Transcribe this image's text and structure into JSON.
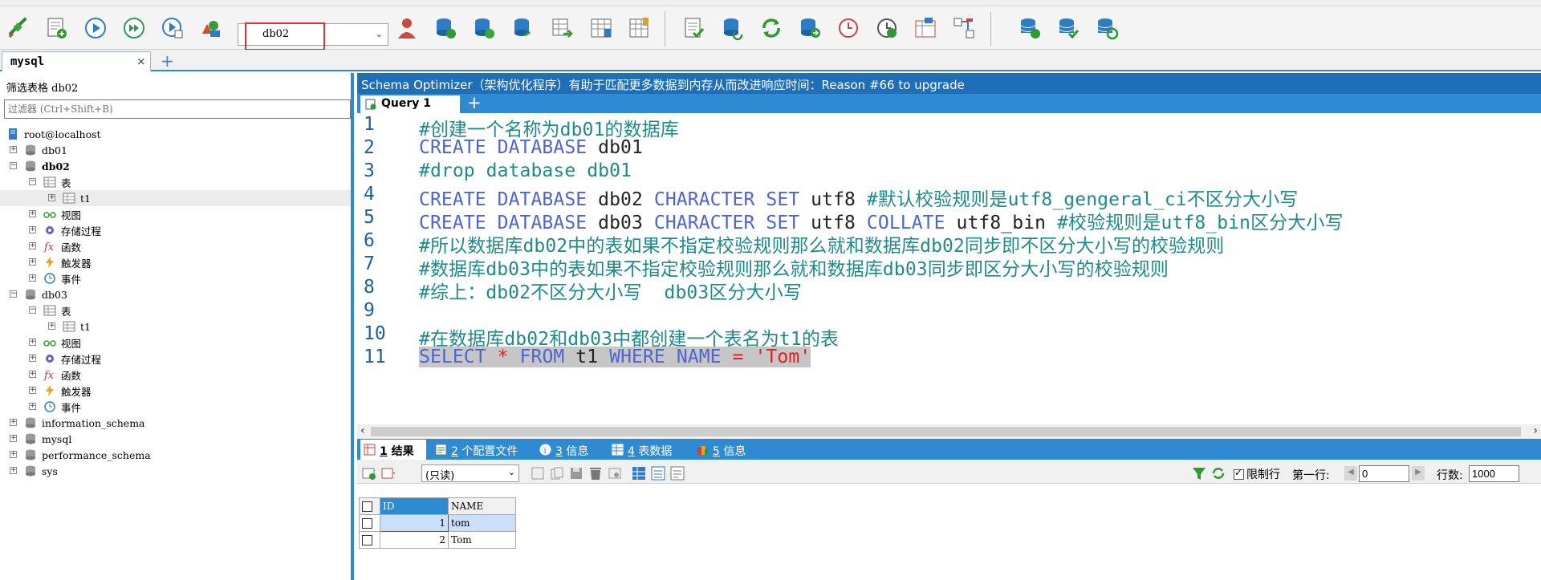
{
  "toolbar": {
    "db_selected": "db02",
    "icons": [
      "connect-icon",
      "new-query-icon",
      "execute-icon",
      "execute-all-icon",
      "execute-explain-icon",
      "new-database-icon",
      "db-select",
      "user-manager-icon",
      "create-table-icon",
      "alter-table-icon",
      "copy-table-icon",
      "import-icon",
      "schema-designer-icon",
      "table-diagnostics-icon",
      "query-builder-icon",
      "backup-icon",
      "restore-icon",
      "sync-icon",
      "database-export-icon",
      "schedule-icon",
      "job-icon",
      "schema-sync-icon",
      "data-sync-icon",
      "stack-add-icon",
      "stack-check-icon",
      "stack-refresh-icon"
    ]
  },
  "connection_tab": {
    "label": "mysql",
    "close": "×",
    "add": "+"
  },
  "object_browser": {
    "filter_label": "筛选表格 db02",
    "filter_placeholder": "过滤器 (Ctrl+Shift+B)",
    "tree": [
      {
        "label": "root@localhost",
        "icon": "server"
      },
      {
        "label": "db01",
        "icon": "database",
        "exp": "+"
      },
      {
        "label": "db02",
        "icon": "database",
        "exp": "-",
        "bold": true
      },
      {
        "label": "表",
        "icon": "table-folder",
        "exp": "-"
      },
      {
        "label": "t1",
        "icon": "table",
        "exp": "+",
        "selected": true
      },
      {
        "label": "视图",
        "icon": "views",
        "exp": "+"
      },
      {
        "label": "存储过程",
        "icon": "gear",
        "exp": "+"
      },
      {
        "label": "函数",
        "icon": "function",
        "exp": "+"
      },
      {
        "label": "触发器",
        "icon": "trigger",
        "exp": "+"
      },
      {
        "label": "事件",
        "icon": "clock",
        "exp": "+"
      },
      {
        "label": "db03",
        "icon": "database",
        "exp": "-"
      },
      {
        "label": "表",
        "icon": "table-folder",
        "exp": "-"
      },
      {
        "label": "t1",
        "icon": "table",
        "exp": "+"
      },
      {
        "label": "视图",
        "icon": "views",
        "exp": "+"
      },
      {
        "label": "存储过程",
        "icon": "gear",
        "exp": "+"
      },
      {
        "label": "函数",
        "icon": "function",
        "exp": "+"
      },
      {
        "label": "触发器",
        "icon": "trigger",
        "exp": "+"
      },
      {
        "label": "事件",
        "icon": "clock",
        "exp": "+"
      },
      {
        "label": "information_schema",
        "icon": "database",
        "exp": "+"
      },
      {
        "label": "mysql",
        "icon": "database",
        "exp": "+"
      },
      {
        "label": "performance_schema",
        "icon": "database",
        "exp": "+"
      },
      {
        "label": "sys",
        "icon": "database",
        "exp": "+"
      }
    ]
  },
  "banner": "Schema Optimizer（架构优化程序）有助于匹配更多数据到内存从而改进响应时间：Reason #66 to upgrade",
  "query_tab": {
    "label": "Query 1",
    "add": "+"
  },
  "editor": {
    "lines": [
      {
        "n": "1",
        "parts": [
          {
            "c": "cm",
            "t": "#创建一个名称为db01的数据库"
          }
        ]
      },
      {
        "n": "2",
        "parts": [
          {
            "c": "kw",
            "t": "CREATE DATABASE"
          },
          {
            "c": "tx",
            "t": " db01"
          }
        ]
      },
      {
        "n": "3",
        "parts": [
          {
            "c": "cm",
            "t": "#drop database db01"
          }
        ]
      },
      {
        "n": "4",
        "parts": [
          {
            "c": "kw",
            "t": "CREATE DATABASE"
          },
          {
            "c": "tx",
            "t": " db02 "
          },
          {
            "c": "kw",
            "t": "CHARACTER SET"
          },
          {
            "c": "tx",
            "t": " utf8 "
          },
          {
            "c": "cm",
            "t": "#默认校验规则是utf8_gengeral_ci不区分大小写"
          }
        ]
      },
      {
        "n": "5",
        "parts": [
          {
            "c": "kw",
            "t": "CREATE DATABASE"
          },
          {
            "c": "tx",
            "t": " db03 "
          },
          {
            "c": "kw",
            "t": "CHARACTER SET"
          },
          {
            "c": "tx",
            "t": " utf8 "
          },
          {
            "c": "kw",
            "t": "COLLATE"
          },
          {
            "c": "tx",
            "t": " utf8_bin "
          },
          {
            "c": "cm",
            "t": "#校验规则是utf8_bin区分大小写"
          }
        ]
      },
      {
        "n": "6",
        "parts": [
          {
            "c": "cm",
            "t": "#所以数据库db02中的表如果不指定校验规则那么就和数据库db02同步即不区分大小写的校验规则"
          }
        ]
      },
      {
        "n": "7",
        "parts": [
          {
            "c": "cm",
            "t": "#数据库db03中的表如果不指定校验规则那么就和数据库db03同步即区分大小写的校验规则"
          }
        ]
      },
      {
        "n": "8",
        "parts": [
          {
            "c": "cm",
            "t": "#综上：db02不区分大小写  db03区分大小写"
          }
        ]
      },
      {
        "n": "9",
        "parts": []
      },
      {
        "n": "10",
        "parts": [
          {
            "c": "cm",
            "t": "#在数据库db02和db03中都创建一个表名为t1的表"
          }
        ]
      },
      {
        "n": "11",
        "parts": [
          {
            "c": "kw",
            "t": "SELECT"
          },
          {
            "c": "tx",
            "t": " "
          },
          {
            "c": "str",
            "t": "*"
          },
          {
            "c": "tx",
            "t": " "
          },
          {
            "c": "kw",
            "t": "FROM"
          },
          {
            "c": "tx",
            "t": " t1 "
          },
          {
            "c": "kw",
            "t": "WHERE NAME"
          },
          {
            "c": "tx",
            "t": " "
          },
          {
            "c": "str",
            "t": "="
          },
          {
            "c": "tx",
            "t": " "
          },
          {
            "c": "str",
            "t": "'Tom'"
          }
        ],
        "highlight": true
      }
    ]
  },
  "result_tabs": [
    {
      "num": "1",
      "label": " 结果",
      "icon": "grid-icon",
      "active": true
    },
    {
      "num": "2",
      "label": " 个配置文件",
      "icon": "profile-icon"
    },
    {
      "num": "3",
      "label": " 信息",
      "icon": "info-icon"
    },
    {
      "num": "4",
      "label": " 表数据",
      "icon": "table-data-icon"
    },
    {
      "num": "5",
      "label": " 信息",
      "icon": "info2-icon"
    }
  ],
  "result_toolbar": {
    "mode": "(只读)",
    "limit_label": "限制行",
    "limit_checked": true,
    "first_row_label": "第一行:",
    "first_row_value": "0",
    "rows_label": "行数:",
    "rows_value": "1000"
  },
  "result_grid": {
    "columns": [
      "ID",
      "NAME"
    ],
    "rows": [
      [
        "1",
        "tom"
      ],
      [
        "2",
        "Tom"
      ]
    ]
  }
}
